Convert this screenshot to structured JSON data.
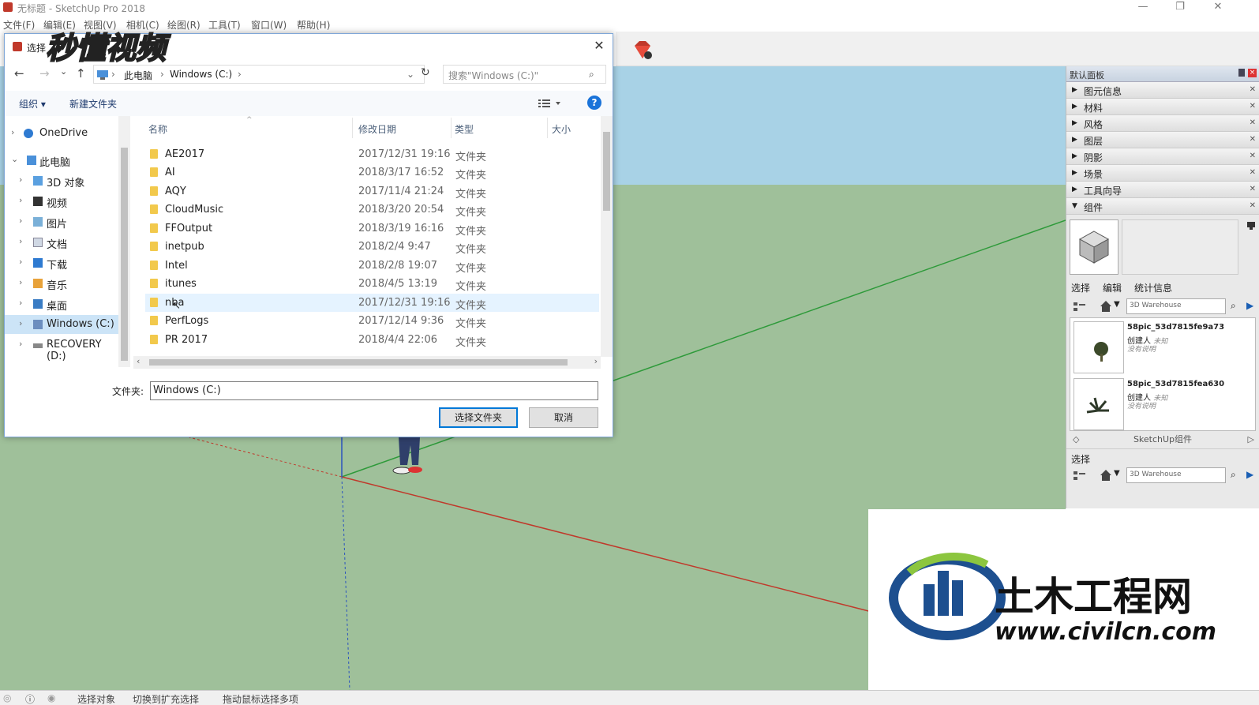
{
  "app": {
    "title": "无标题 - SketchUp Pro 2018",
    "menu": [
      "文件(F)",
      "编辑(E)",
      "视图(V)",
      "相机(C)",
      "绘图(R)",
      "工具(T)",
      "窗口(W)",
      "帮助(H)"
    ],
    "window_controls": [
      "—",
      "❐",
      "✕"
    ]
  },
  "dialog": {
    "title": "选择",
    "close": "✕",
    "nav": {
      "back": "←",
      "forward": "→",
      "recent": "⌄",
      "up": "↑",
      "refresh": "↻"
    },
    "breadcrumb": [
      "此电脑",
      "Windows (C:)"
    ],
    "search_placeholder": "搜索\"Windows (C:)\"",
    "commands": {
      "organize": "组织 ▾",
      "new_folder": "新建文件夹",
      "help": "?"
    },
    "navpane": [
      {
        "label": "OneDrive",
        "icon": "cloud-icon",
        "chev": "›"
      },
      {
        "label": "此电脑",
        "icon": "computer-icon",
        "chev": "⌄"
      },
      {
        "label": "3D 对象",
        "icon": "cube-icon",
        "chev": "›"
      },
      {
        "label": "视频",
        "icon": "video-icon",
        "chev": "›"
      },
      {
        "label": "图片",
        "icon": "picture-icon",
        "chev": "›"
      },
      {
        "label": "文档",
        "icon": "document-icon",
        "chev": "›"
      },
      {
        "label": "下载",
        "icon": "download-icon",
        "chev": "›"
      },
      {
        "label": "音乐",
        "icon": "music-icon",
        "chev": "›"
      },
      {
        "label": "桌面",
        "icon": "desktop-icon",
        "chev": "›"
      },
      {
        "label": "Windows (C:)",
        "icon": "drive-icon",
        "chev": "›"
      },
      {
        "label": "RECOVERY (D:)",
        "icon": "drive-icon",
        "chev": "›"
      }
    ],
    "columns": {
      "name": "名称",
      "modified": "修改日期",
      "type": "类型",
      "size": "大小"
    },
    "files": [
      {
        "name": "AE2017",
        "date": "2017/12/31 19:16",
        "type": "文件夹"
      },
      {
        "name": "AI",
        "date": "2018/3/17 16:52",
        "type": "文件夹"
      },
      {
        "name": "AQY",
        "date": "2017/11/4 21:24",
        "type": "文件夹"
      },
      {
        "name": "CloudMusic",
        "date": "2018/3/20 20:54",
        "type": "文件夹"
      },
      {
        "name": "FFOutput",
        "date": "2018/3/19 16:16",
        "type": "文件夹"
      },
      {
        "name": "inetpub",
        "date": "2018/2/4 9:47",
        "type": "文件夹"
      },
      {
        "name": "Intel",
        "date": "2018/2/8 19:07",
        "type": "文件夹"
      },
      {
        "name": "itunes",
        "date": "2018/4/5 13:19",
        "type": "文件夹"
      },
      {
        "name": "nba",
        "date": "2017/12/31 19:16",
        "type": "文件夹"
      },
      {
        "name": "PerfLogs",
        "date": "2017/12/14 9:36",
        "type": "文件夹"
      },
      {
        "name": "PR 2017",
        "date": "2018/4/4 22:06",
        "type": "文件夹"
      }
    ],
    "folder_label": "文件夹:",
    "folder_value": "Windows (C:)",
    "select_button": "选择文件夹",
    "cancel_button": "取消"
  },
  "tray": {
    "title": "默认面板",
    "panels": [
      {
        "label": "图元信息",
        "arrow": "▶"
      },
      {
        "label": "材料",
        "arrow": "▶"
      },
      {
        "label": "风格",
        "arrow": "▶"
      },
      {
        "label": "图层",
        "arrow": "▶"
      },
      {
        "label": "阴影",
        "arrow": "▶"
      },
      {
        "label": "场景",
        "arrow": "▶"
      },
      {
        "label": "工具向导",
        "arrow": "▶"
      },
      {
        "label": "组件",
        "arrow": "▼"
      }
    ],
    "tabs": [
      "选择",
      "编辑",
      "统计信息"
    ],
    "search_value": "3D Warehouse",
    "results": [
      {
        "name": "58pic_53d7815fe9a73",
        "by": "创建人",
        "by_value": "未知",
        "desc": "没有说明"
      },
      {
        "name": "58pic_53d7815fea630",
        "by": "创建人",
        "by_value": "未知",
        "desc": "没有说明"
      }
    ],
    "collection": "SketchUp组件",
    "second_title": "选择",
    "second_search": "3D Warehouse"
  },
  "status": {
    "items": [
      "选择对象",
      "切换到扩充选择",
      "拖动鼠标选择多项"
    ]
  },
  "watermarks": {
    "top": "秒懂视频",
    "bottom_cn": "土木工程网",
    "bottom_url": "www.civilcn.com"
  },
  "colors": {
    "ground": "#9fc09a",
    "sky": "#a8d2e6",
    "accent": "#0078d7",
    "axis_red": "#c0392b",
    "axis_green": "#2e9a3a",
    "axis_blue": "#2a52be"
  }
}
